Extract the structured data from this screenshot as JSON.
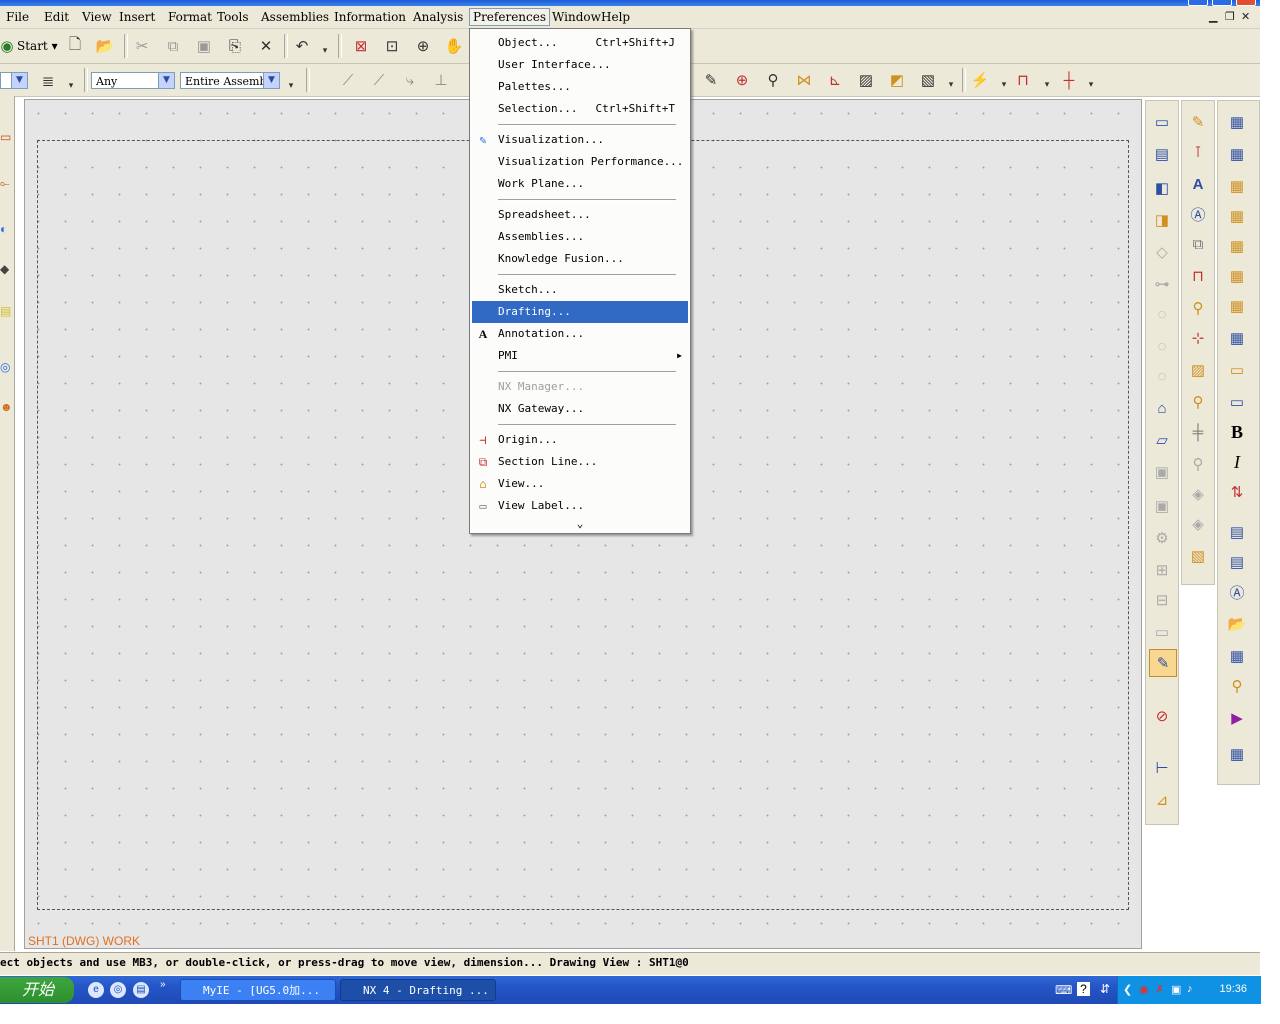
{
  "menubar": {
    "items": [
      "File",
      "Edit",
      "View",
      "Insert",
      "Format",
      "Tools",
      "Assemblies",
      "Information",
      "Analysis",
      "Preferences",
      "Window",
      "Help"
    ],
    "active": "Preferences"
  },
  "toolbar1": {
    "start_label": "Start"
  },
  "toolbar2": {
    "filter_value": "Any",
    "scope_value": "Entire Assemb"
  },
  "preferences_menu": {
    "items": [
      {
        "label": "Object...",
        "shortcut": "Ctrl+Shift+J"
      },
      {
        "label": "User Interface..."
      },
      {
        "label": "Palettes..."
      },
      {
        "label": "Selection...",
        "shortcut": "Ctrl+Shift+T"
      },
      {
        "label": "Visualization..."
      },
      {
        "label": "Visualization Performance..."
      },
      {
        "label": "Work Plane..."
      },
      {
        "label": "Spreadsheet..."
      },
      {
        "label": "Assemblies..."
      },
      {
        "label": "Knowledge Fusion..."
      },
      {
        "label": "Sketch..."
      },
      {
        "label": "Drafting...",
        "highlighted": true
      },
      {
        "label": "Annotation..."
      },
      {
        "label": "PMI"
      },
      {
        "label": "NX Manager...",
        "disabled": true
      },
      {
        "label": "NX Gateway..."
      },
      {
        "label": "Origin..."
      },
      {
        "label": "Section Line..."
      },
      {
        "label": "View..."
      },
      {
        "label": "View Label..."
      }
    ],
    "expand_glyph": "⌄"
  },
  "canvas": {
    "sheet_label": "SHT1 (DWG) WORK"
  },
  "statusbar": {
    "text": "ect objects and use MB3, or double-click, or press-drag to move view, dimension... Drawing View : SHT1@0"
  },
  "taskbar": {
    "start_label": "开始",
    "tasks": [
      "MyIE - [UG5.0加...",
      "NX 4 - Drafting ..."
    ],
    "clock": "19:36"
  },
  "colors": {
    "menu_highlight": "#316ac5",
    "sheet_label": "#e07020",
    "taskbar": "#2454c7",
    "start_button": "#3fa63f"
  }
}
